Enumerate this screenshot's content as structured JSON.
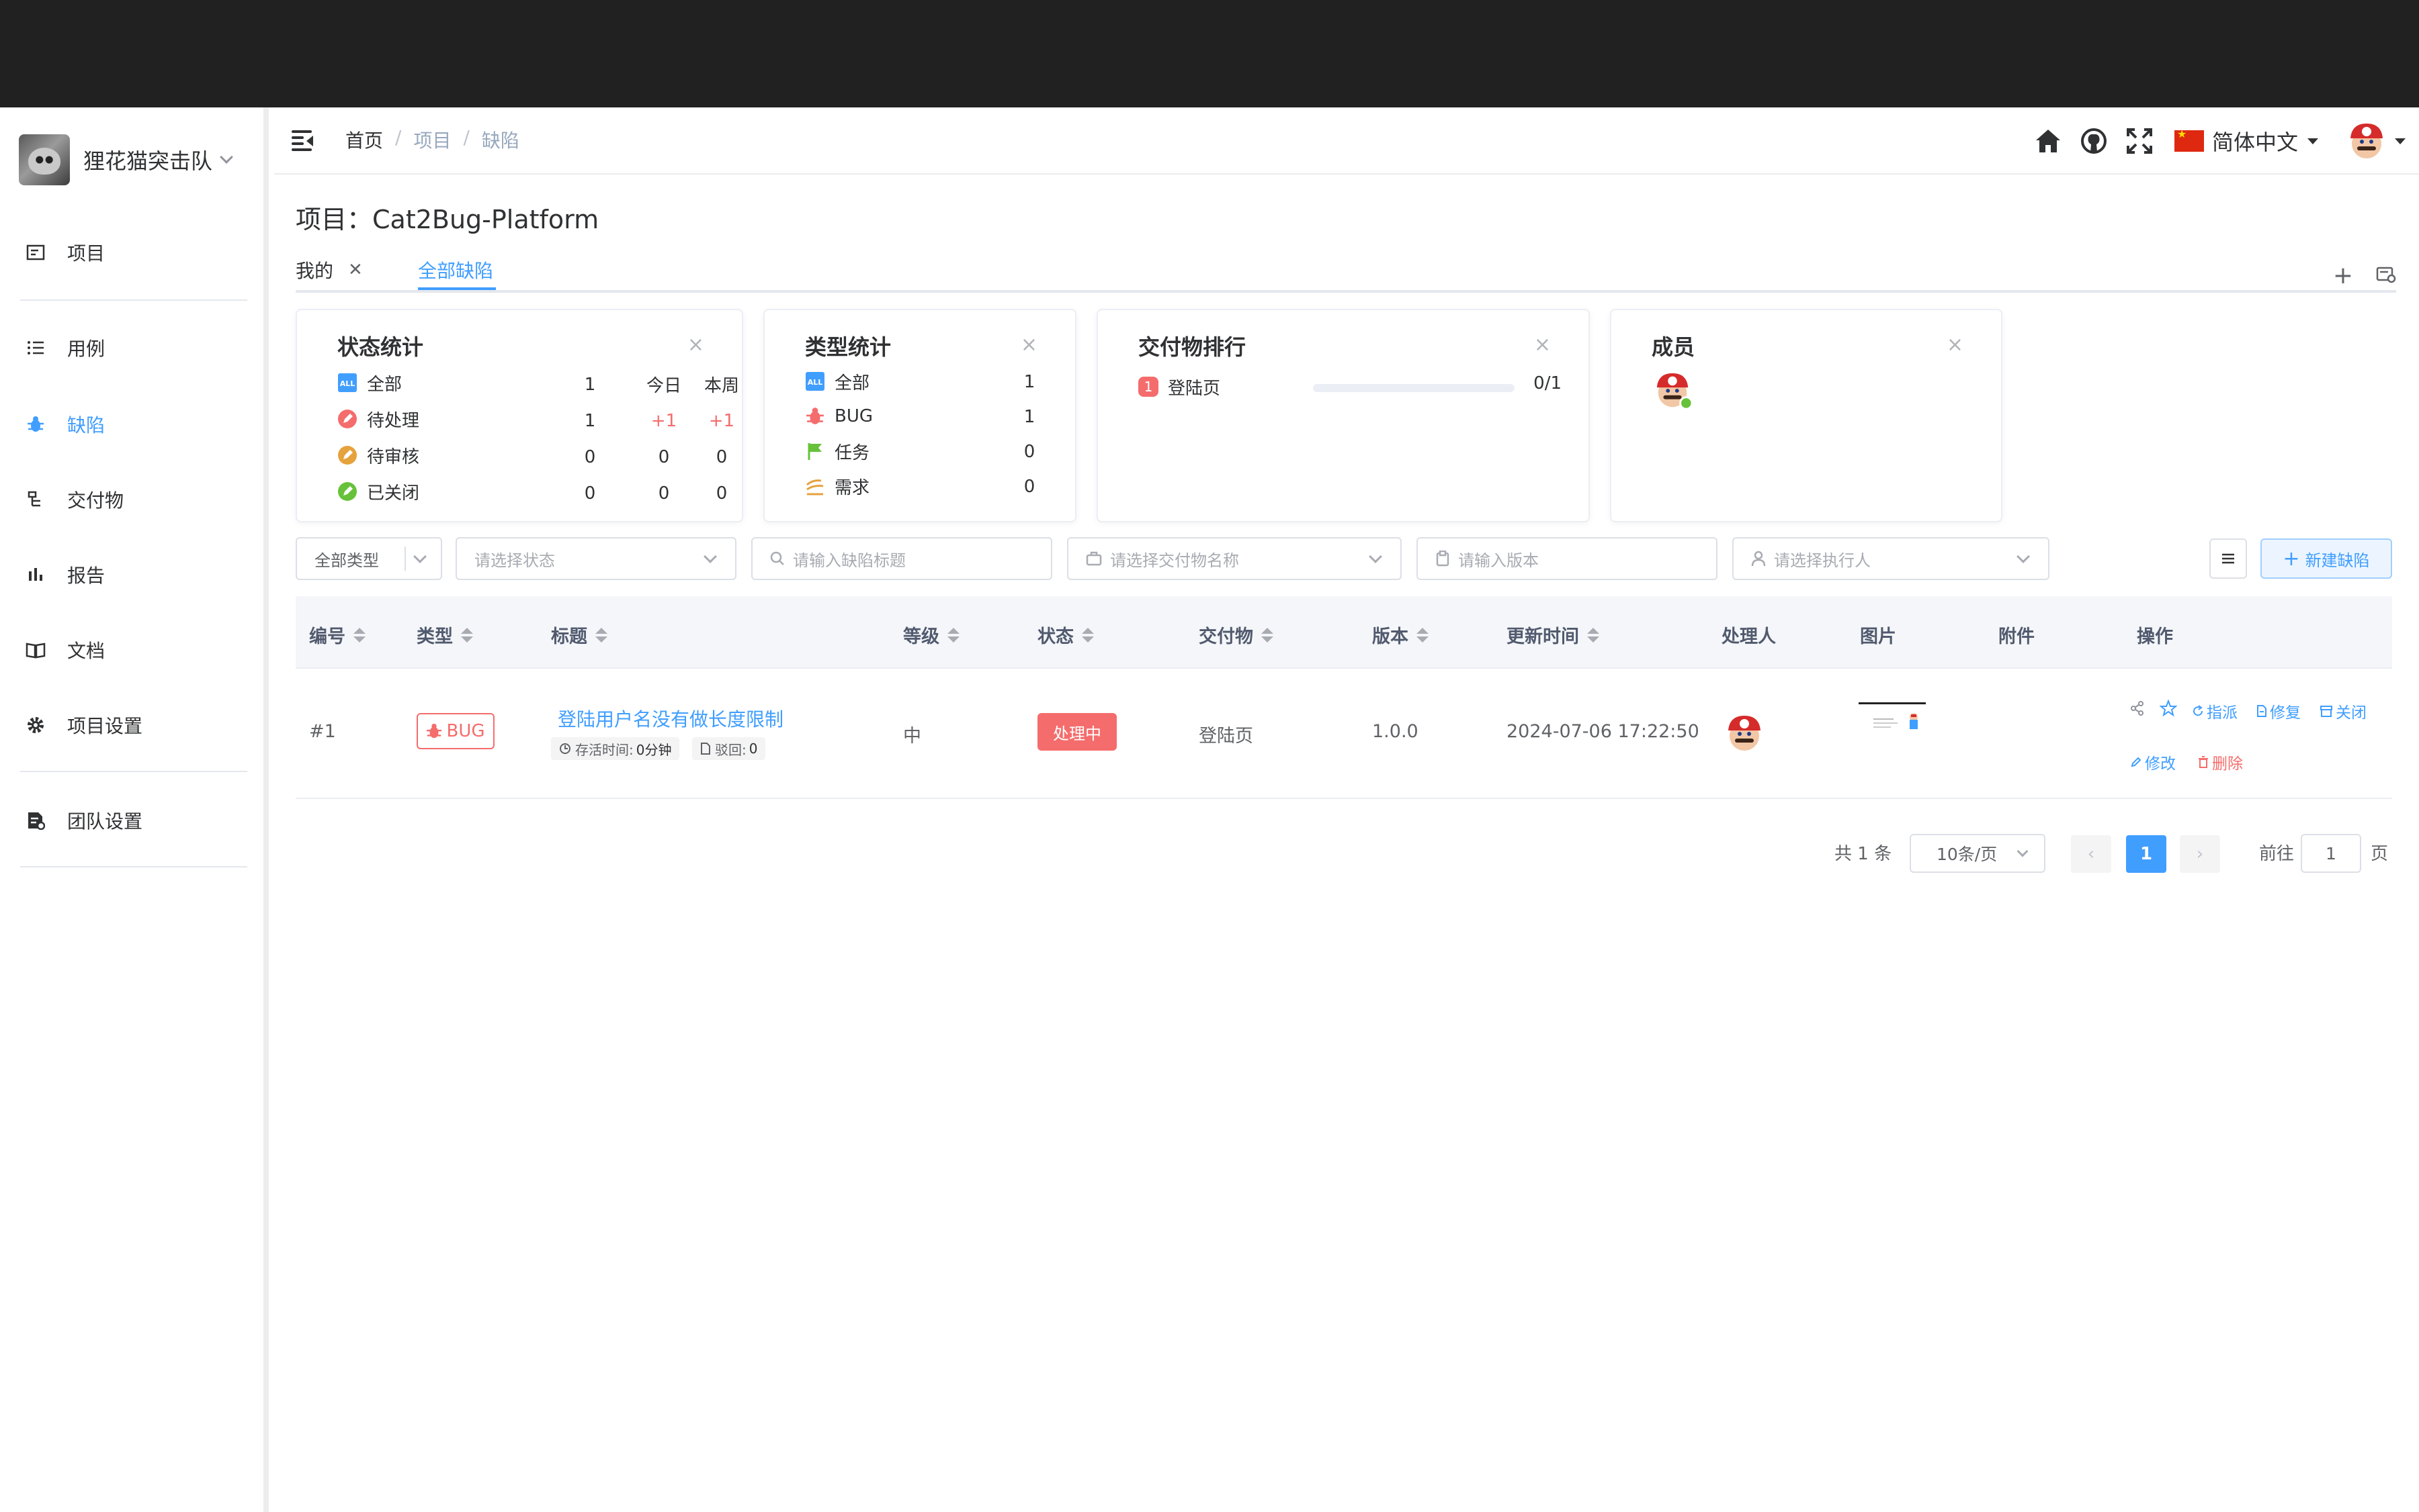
{
  "team": {
    "name": "狸花猫突击队"
  },
  "sidebar": {
    "items": [
      {
        "label": "项目",
        "icon": "project-icon"
      },
      {
        "label": "用例",
        "icon": "case-list-icon"
      },
      {
        "label": "缺陷",
        "icon": "bug-icon",
        "active": true
      },
      {
        "label": "交付物",
        "icon": "deliverable-icon"
      },
      {
        "label": "报告",
        "icon": "report-chart-icon"
      },
      {
        "label": "文档",
        "icon": "book-icon"
      },
      {
        "label": "项目设置",
        "icon": "gear-icon"
      },
      {
        "label": "团队设置",
        "icon": "team-settings-icon"
      }
    ]
  },
  "header": {
    "breadcrumb": [
      "首页",
      "项目",
      "缺陷"
    ],
    "breadcrumb_sep": "/",
    "language": "简体中文"
  },
  "project": {
    "title": "项目：Cat2Bug-Platform"
  },
  "tabs": [
    {
      "label": "我的",
      "closable": true
    },
    {
      "label": "全部缺陷",
      "active": true
    }
  ],
  "tab_tools": {
    "add": "+"
  },
  "cards": {
    "status": {
      "title": "状态统计",
      "close": "×",
      "col_today": "今日",
      "col_week": "本周",
      "rows": [
        {
          "label": "全部",
          "total": "1",
          "today": "",
          "week": ""
        },
        {
          "label": "待处理",
          "total": "1",
          "today": "+1",
          "week": "+1"
        },
        {
          "label": "待审核",
          "total": "0",
          "today": "0",
          "week": "0"
        },
        {
          "label": "已关闭",
          "total": "0",
          "today": "0",
          "week": "0"
        }
      ]
    },
    "types": {
      "title": "类型统计",
      "close": "×",
      "rows": [
        {
          "label": "全部",
          "value": "1"
        },
        {
          "label": "BUG",
          "value": "1"
        },
        {
          "label": "任务",
          "value": "0"
        },
        {
          "label": "需求",
          "value": "0"
        }
      ]
    },
    "deliverables": {
      "title": "交付物排行",
      "close": "×",
      "items": [
        {
          "rank": "1",
          "name": "登陆页",
          "progress_text": "0/1",
          "progress": 0
        }
      ]
    },
    "members": {
      "title": "成员",
      "close": "×"
    }
  },
  "filters": {
    "type": "全部类型",
    "status_placeholder": "请选择状态",
    "title_placeholder": "请输入缺陷标题",
    "deliverable_placeholder": "请选择交付物名称",
    "version_placeholder": "请输入版本",
    "assignee_placeholder": "请选择执行人",
    "new_button": "新建缺陷"
  },
  "table": {
    "columns": [
      "编号",
      "类型",
      "标题",
      "等级",
      "状态",
      "交付物",
      "版本",
      "更新时间",
      "处理人",
      "图片",
      "附件",
      "操作"
    ],
    "rows": [
      {
        "id": "#1",
        "type": "BUG",
        "title": "登陆用户名没有做长度限制",
        "alive_label": "存活时间:",
        "alive_value": "0分钟",
        "rejected_label": "驳回:",
        "rejected_value": "0",
        "level": "中",
        "status": "处理中",
        "deliverable": "登陆页",
        "version": "1.0.0",
        "updated": "2024-07-06 17:22:50",
        "actions": {
          "assign": "指派",
          "fix": "修复",
          "close": "关闭",
          "edit": "修改",
          "delete": "删除"
        }
      }
    ]
  },
  "pagination": {
    "total": "共 1 条",
    "page_size": "10条/页",
    "current": "1",
    "goto_prefix": "前往",
    "goto_value": "1",
    "goto_suffix": "页"
  },
  "colors": {
    "primary": "#409eff",
    "danger": "#f56c6c",
    "success": "#67c23a",
    "warning": "#e6a23c"
  }
}
